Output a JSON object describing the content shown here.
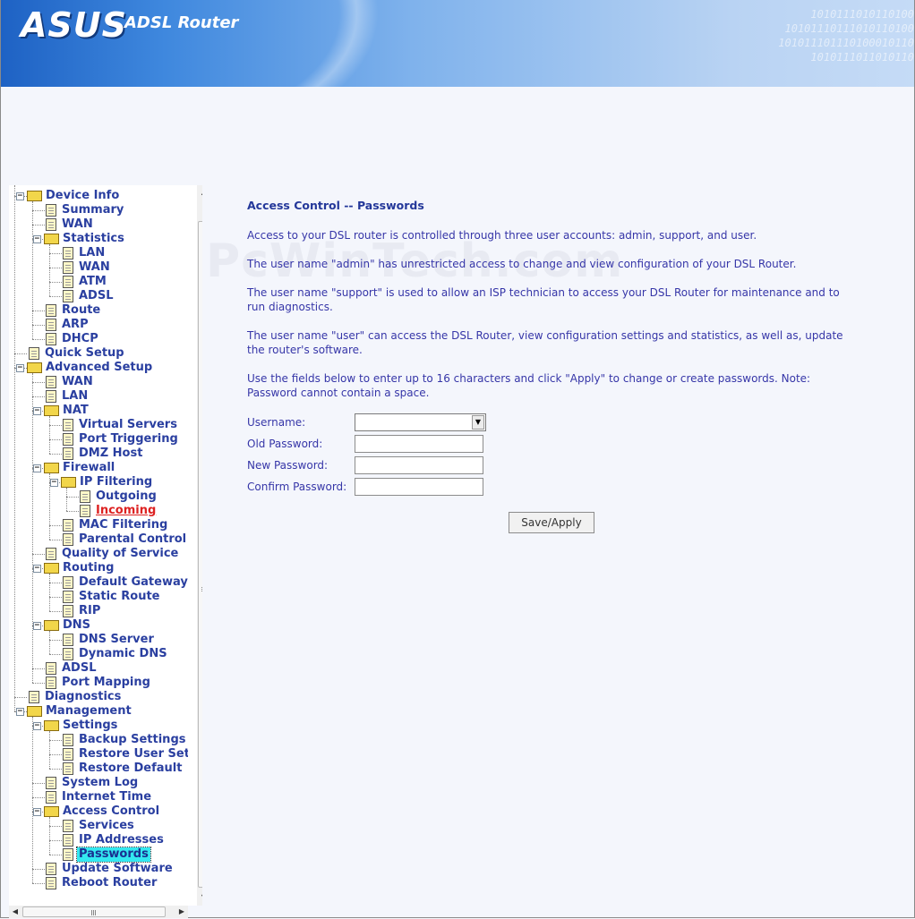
{
  "header": {
    "logo_text": "ASUS",
    "product_name": "ADSL Router",
    "binary_lines": [
      "1010111010110100",
      "10101110111010110100",
      "101011101110100010110",
      "1010111011010110"
    ]
  },
  "watermark": "PcWinTech.com",
  "nav": {
    "items": [
      {
        "label": "Device Info",
        "icon": "folder-icon",
        "expanded": true
      },
      {
        "label": "Summary",
        "icon": "document-icon"
      },
      {
        "label": "WAN",
        "icon": "document-icon"
      },
      {
        "label": "Statistics",
        "icon": "folder-icon",
        "expanded": true
      },
      {
        "label": "LAN",
        "icon": "document-icon"
      },
      {
        "label": "WAN",
        "icon": "document-icon"
      },
      {
        "label": "ATM",
        "icon": "document-icon"
      },
      {
        "label": "ADSL",
        "icon": "document-icon"
      },
      {
        "label": "Route",
        "icon": "document-icon"
      },
      {
        "label": "ARP",
        "icon": "document-icon"
      },
      {
        "label": "DHCP",
        "icon": "document-icon"
      },
      {
        "label": "Quick Setup",
        "icon": "document-icon"
      },
      {
        "label": "Advanced Setup",
        "icon": "folder-icon",
        "expanded": true
      },
      {
        "label": "WAN",
        "icon": "document-icon"
      },
      {
        "label": "LAN",
        "icon": "document-icon"
      },
      {
        "label": "NAT",
        "icon": "folder-icon",
        "expanded": true
      },
      {
        "label": "Virtual Servers",
        "icon": "document-icon"
      },
      {
        "label": "Port Triggering",
        "icon": "document-icon"
      },
      {
        "label": "DMZ Host",
        "icon": "document-icon"
      },
      {
        "label": "Firewall",
        "icon": "folder-icon",
        "expanded": true
      },
      {
        "label": "IP Filtering",
        "icon": "folder-icon",
        "expanded": true
      },
      {
        "label": "Outgoing",
        "icon": "document-icon"
      },
      {
        "label": "Incoming",
        "icon": "document-icon",
        "visited": true
      },
      {
        "label": "MAC Filtering",
        "icon": "document-icon"
      },
      {
        "label": "Parental Control",
        "icon": "document-icon"
      },
      {
        "label": "Quality of Service",
        "icon": "document-icon"
      },
      {
        "label": "Routing",
        "icon": "folder-icon",
        "expanded": true
      },
      {
        "label": "Default Gateway",
        "icon": "document-icon"
      },
      {
        "label": "Static Route",
        "icon": "document-icon"
      },
      {
        "label": "RIP",
        "icon": "document-icon"
      },
      {
        "label": "DNS",
        "icon": "folder-icon",
        "expanded": true
      },
      {
        "label": "DNS Server",
        "icon": "document-icon"
      },
      {
        "label": "Dynamic DNS",
        "icon": "document-icon"
      },
      {
        "label": "ADSL",
        "icon": "document-icon"
      },
      {
        "label": "Port Mapping",
        "icon": "document-icon"
      },
      {
        "label": "Diagnostics",
        "icon": "document-icon"
      },
      {
        "label": "Management",
        "icon": "folder-icon",
        "expanded": true
      },
      {
        "label": "Settings",
        "icon": "folder-icon",
        "expanded": true
      },
      {
        "label": "Backup Settings",
        "icon": "document-icon"
      },
      {
        "label": "Restore User Settin",
        "icon": "document-icon"
      },
      {
        "label": "Restore Default",
        "icon": "document-icon"
      },
      {
        "label": "System Log",
        "icon": "document-icon"
      },
      {
        "label": "Internet Time",
        "icon": "document-icon"
      },
      {
        "label": "Access Control",
        "icon": "folder-icon",
        "expanded": true
      },
      {
        "label": "Services",
        "icon": "document-icon"
      },
      {
        "label": "IP Addresses",
        "icon": "document-icon"
      },
      {
        "label": "Passwords",
        "icon": "document-icon",
        "active": true
      },
      {
        "label": "Update Software",
        "icon": "document-icon"
      },
      {
        "label": "Reboot Router",
        "icon": "document-icon"
      }
    ]
  },
  "main": {
    "title": "Access Control -- Passwords",
    "paragraphs": [
      "Access to your DSL router is controlled through three user accounts: admin, support, and user.",
      "The user name \"admin\" has unrestricted access to change and view configuration of your DSL Router.",
      "The user name \"support\" is used to allow an ISP technician to access your DSL Router for maintenance and to run diagnostics.",
      "The user name \"user\" can access the DSL Router, view configuration settings and statistics, as well as, update the router's software.",
      "Use the fields below to enter up to 16 characters and click \"Apply\" to change or create passwords. Note: Password cannot contain a space."
    ],
    "form": {
      "username_label": "Username:",
      "username_value": "",
      "old_password_label": "Old Password:",
      "old_password_value": "",
      "new_password_label": "New Password:",
      "new_password_value": "",
      "confirm_password_label": "Confirm Password:",
      "confirm_password_value": ""
    },
    "apply_label": "Save/Apply"
  },
  "scrollbar": {
    "up_arrow": "▲",
    "down_arrow": "▼",
    "left_arrow": "◀",
    "right_arrow": "▶"
  }
}
